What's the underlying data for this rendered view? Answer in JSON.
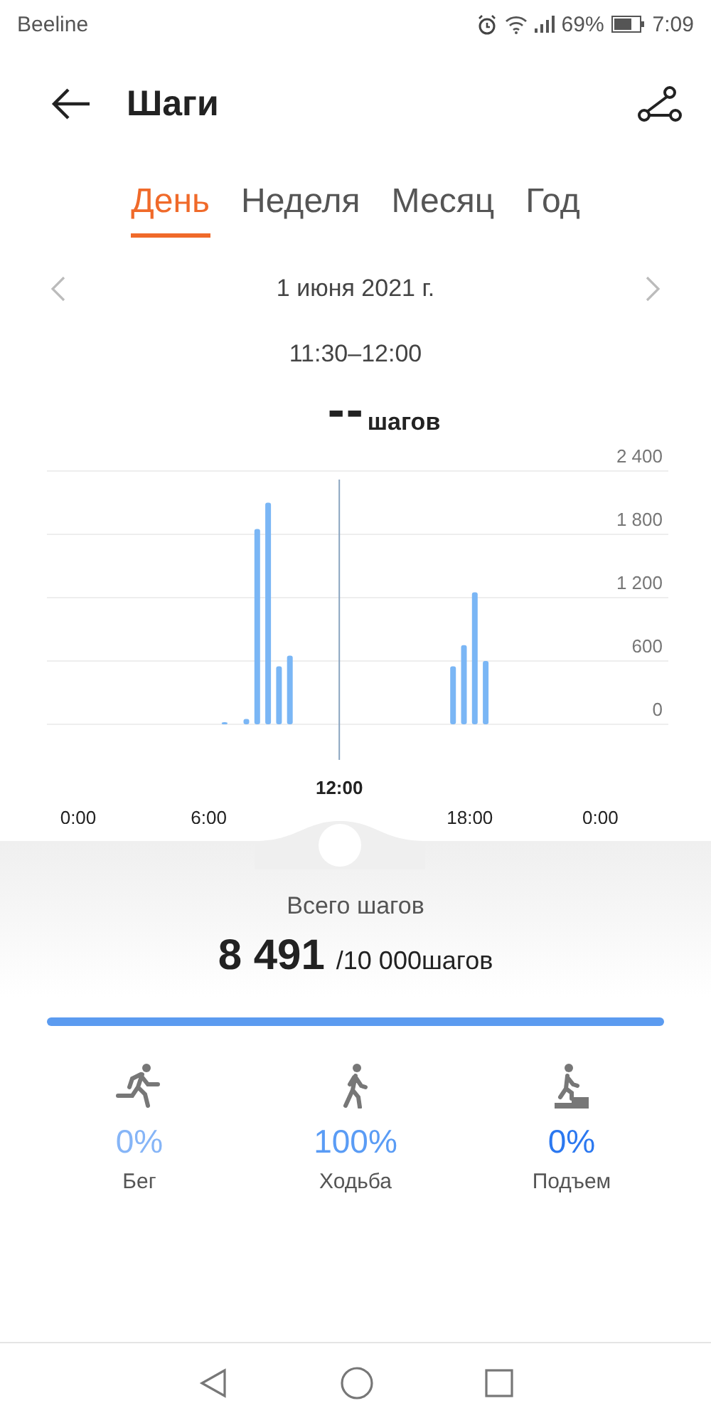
{
  "status_bar": {
    "carrier": "Beeline",
    "battery": "69%",
    "time": "7:09"
  },
  "header": {
    "title": "Шаги"
  },
  "tabs": [
    {
      "label": "День",
      "selected": true
    },
    {
      "label": "Неделя",
      "selected": false
    },
    {
      "label": "Месяц",
      "selected": false
    },
    {
      "label": "Год",
      "selected": false
    }
  ],
  "date": "1 июня 2021 г.",
  "time_range": "11:30–12:00",
  "reading": {
    "value": "--",
    "unit": "шагов"
  },
  "chart": {
    "chart_data": {
      "type": "bar",
      "grid": true,
      "x": [
        6.5,
        7.5,
        8,
        8.5,
        9,
        9.5,
        17,
        17.5,
        18,
        18.5
      ],
      "values": [
        20,
        50,
        1850,
        2100,
        550,
        650,
        550,
        750,
        1250,
        600
      ],
      "ref_lines": [
        {
          "axis": "x",
          "value": 12,
          "label": "12:00"
        }
      ],
      "xlim": [
        0,
        24
      ],
      "ylim": [
        0,
        2400
      ],
      "xticks": [
        {
          "value": 0,
          "label": "0:00"
        },
        {
          "value": 6,
          "label": "6:00"
        },
        {
          "value": 18,
          "label": "18:00"
        },
        {
          "value": 24,
          "label": "0:00"
        }
      ],
      "yticks": [
        {
          "value": 0,
          "label": "0"
        },
        {
          "value": 600,
          "label": "600"
        },
        {
          "value": 1200,
          "label": "1 200"
        },
        {
          "value": 1800,
          "label": "1 800"
        },
        {
          "value": 2400,
          "label": "2 400"
        }
      ]
    }
  },
  "summary": {
    "label": "Всего шагов",
    "total": "8 491",
    "goal": "/10 000шагов"
  },
  "activities": [
    {
      "kind": "run",
      "percent": "0%",
      "label": "Бег",
      "color": "#86b5f7"
    },
    {
      "kind": "walk",
      "percent": "100%",
      "label": "Ходьба",
      "color": "#5a9cf5"
    },
    {
      "kind": "climb",
      "percent": "0%",
      "label": "Подъем",
      "color": "#2b78f0"
    }
  ]
}
